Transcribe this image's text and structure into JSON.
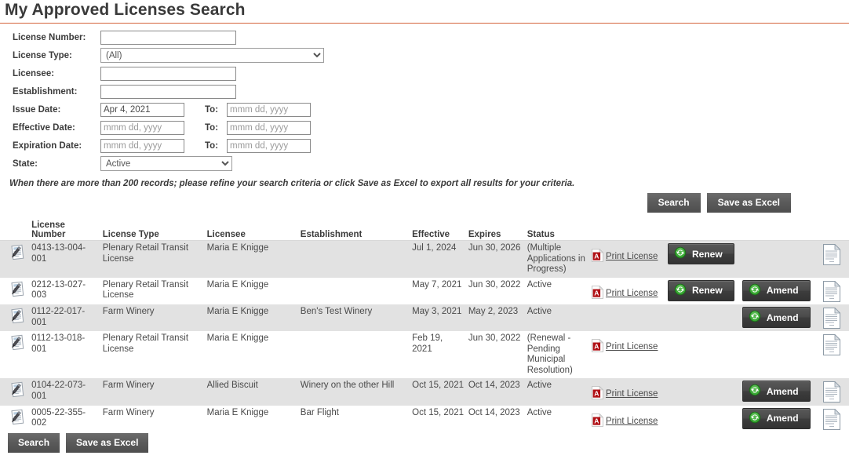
{
  "header": {
    "title": "My Approved Licenses Search",
    "rule_color": "#d4643c"
  },
  "form": {
    "fields": {
      "license_number": {
        "label": "License Number:",
        "value": "",
        "placeholder": ""
      },
      "license_type": {
        "label": "License Type:",
        "value": "(All)",
        "options": [
          "(All)"
        ]
      },
      "licensee": {
        "label": "Licensee:",
        "value": "",
        "placeholder": ""
      },
      "establishment": {
        "label": "Establishment:",
        "value": "",
        "placeholder": ""
      },
      "issue_date": {
        "label": "Issue Date:",
        "from_value": "Apr 4, 2021",
        "from_placeholder": "mmm dd, yyyy",
        "to_label": "To:",
        "to_value": "",
        "to_placeholder": "mmm dd, yyyy"
      },
      "effective_date": {
        "label": "Effective Date:",
        "from_value": "",
        "from_placeholder": "mmm dd, yyyy",
        "to_label": "To:",
        "to_value": "",
        "to_placeholder": "mmm dd, yyyy"
      },
      "expiration_date": {
        "label": "Expiration Date:",
        "from_value": "",
        "from_placeholder": "mmm dd, yyyy",
        "to_label": "To:",
        "to_value": "",
        "to_placeholder": "mmm dd, yyyy"
      },
      "state": {
        "label": "State:",
        "value": "Active",
        "options": [
          "Active"
        ]
      }
    },
    "note": "When there are more than 200 records; please refine your search criteria or click Save as Excel to export all results for your criteria."
  },
  "actions": {
    "search_label": "Search",
    "save_excel_label": "Save as Excel",
    "renew_label": "Renew",
    "amend_label": "Amend",
    "print_license_label": "Print License"
  },
  "table": {
    "columns": [
      {
        "key": "icon",
        "label": ""
      },
      {
        "key": "license_number",
        "label": "License Number"
      },
      {
        "key": "license_type",
        "label": "License Type"
      },
      {
        "key": "licensee",
        "label": "Licensee"
      },
      {
        "key": "establishment",
        "label": "Establishment"
      },
      {
        "key": "effective",
        "label": "Effective"
      },
      {
        "key": "expires",
        "label": "Expires"
      },
      {
        "key": "status",
        "label": "Status"
      },
      {
        "key": "print",
        "label": ""
      },
      {
        "key": "action1",
        "label": ""
      },
      {
        "key": "action2",
        "label": ""
      },
      {
        "key": "doc",
        "label": ""
      }
    ],
    "rows": [
      {
        "license_number": "0413-13-004-001",
        "license_type": "Plenary Retail Transit License",
        "licensee": "Maria E Knigge",
        "establishment": "",
        "effective": "Jul 1, 2024",
        "expires": "Jun 30, 2026",
        "status": "(Multiple Applications in Progress)",
        "has_print": true,
        "action1": "Renew",
        "action2": "",
        "shaded": true
      },
      {
        "license_number": "0212-13-027-003",
        "license_type": "Plenary Retail Transit License",
        "licensee": "Maria E Knigge",
        "establishment": "",
        "effective": "May 7, 2021",
        "expires": "Jun 30, 2022",
        "status": "Active",
        "has_print": true,
        "action1": "Renew",
        "action2": "Amend",
        "shaded": false
      },
      {
        "license_number": "0112-22-017-001",
        "license_type": "Farm Winery",
        "licensee": "Maria E Knigge",
        "establishment": "Ben's Test Winery",
        "effective": "May 3, 2021",
        "expires": "May 2, 2023",
        "status": "Active",
        "has_print": false,
        "action1": "",
        "action2": "Amend",
        "shaded": true
      },
      {
        "license_number": "0112-13-018-001",
        "license_type": "Plenary Retail Transit License",
        "licensee": "Maria E Knigge",
        "establishment": "",
        "effective": "Feb 19, 2021",
        "expires": "Jun 30, 2022",
        "status": "(Renewal - Pending Municipal Resolution)",
        "has_print": true,
        "action1": "",
        "action2": "",
        "shaded": false
      },
      {
        "license_number": "0104-22-073-001",
        "license_type": "Farm Winery",
        "licensee": "Allied Biscuit",
        "establishment": "Winery on the other Hill",
        "effective": "Oct 15, 2021",
        "expires": "Oct 14, 2023",
        "status": "Active",
        "has_print": true,
        "action1": "",
        "action2": "Amend",
        "shaded": true
      },
      {
        "license_number": "0005-22-355-002",
        "license_type": "Farm Winery",
        "licensee": "Maria E Knigge",
        "establishment": "Bar Flight",
        "effective": "Oct 15, 2021",
        "expires": "Oct 14, 2023",
        "status": "Active",
        "has_print": true,
        "action1": "",
        "action2": "Amend",
        "shaded": false
      }
    ]
  },
  "icons": {
    "row_left": "sign-document-icon",
    "row_right": "document-icon",
    "print": "pdf-icon",
    "action": "refresh-icon"
  },
  "colors": {
    "accent_rule": "#d4643c",
    "button_gray": "#5a5a5a",
    "action_button": "#3d3d3d",
    "refresh_green": "#3aaa35",
    "row_shade": "#e2e2e2",
    "pdf_red": "#b01116"
  }
}
